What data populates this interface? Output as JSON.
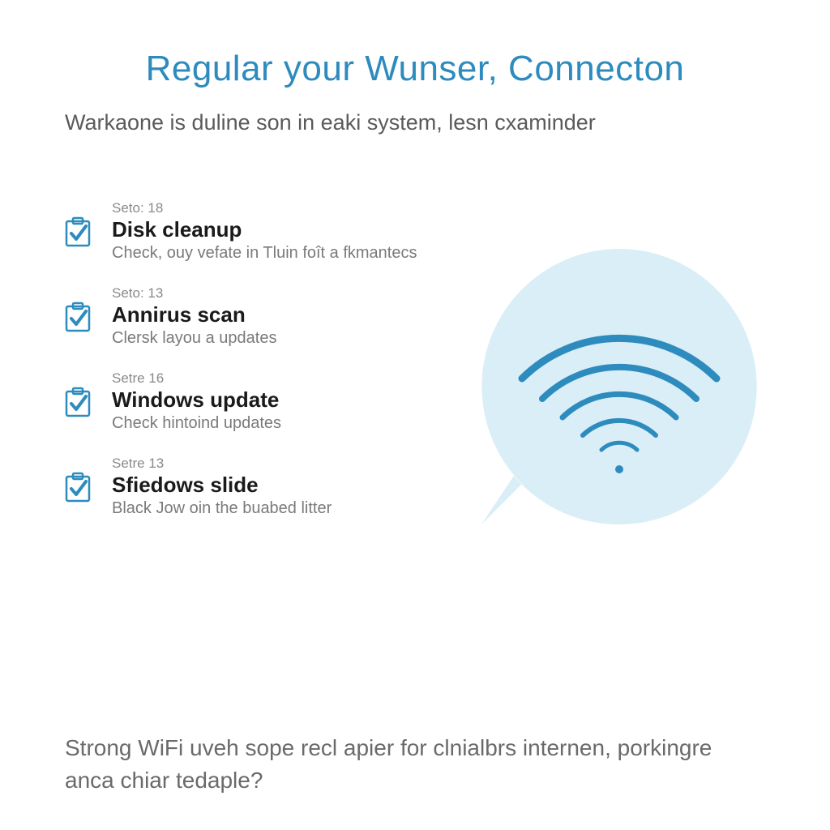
{
  "header": {
    "title": "Regular your Wunser, Connecton",
    "subtitle": "Warkaone is duline son in eaki system, lesn cxaminder"
  },
  "tasks": [
    {
      "meta": "Seto: 18",
      "title": "Disk cleanup",
      "desc": "Check, ouy vefate in Tluin foît a fkmantecs"
    },
    {
      "meta": "Seto: 13",
      "title": "Annirus scan",
      "desc": "Clersk layou a updates"
    },
    {
      "meta": "Setre 16",
      "title": "Windows update",
      "desc": "Check hintoind updates"
    },
    {
      "meta": "Setre 13",
      "title": "Sfiedows slide",
      "desc": "Black Jow oin the buabed litter"
    }
  ],
  "footer": "Strong WiFi uveh sope recl apier for clnialbrs internen, porkingre anca chiar tedaple?",
  "colors": {
    "accent": "#2d8bbe",
    "bubble": "#d9eef6"
  }
}
